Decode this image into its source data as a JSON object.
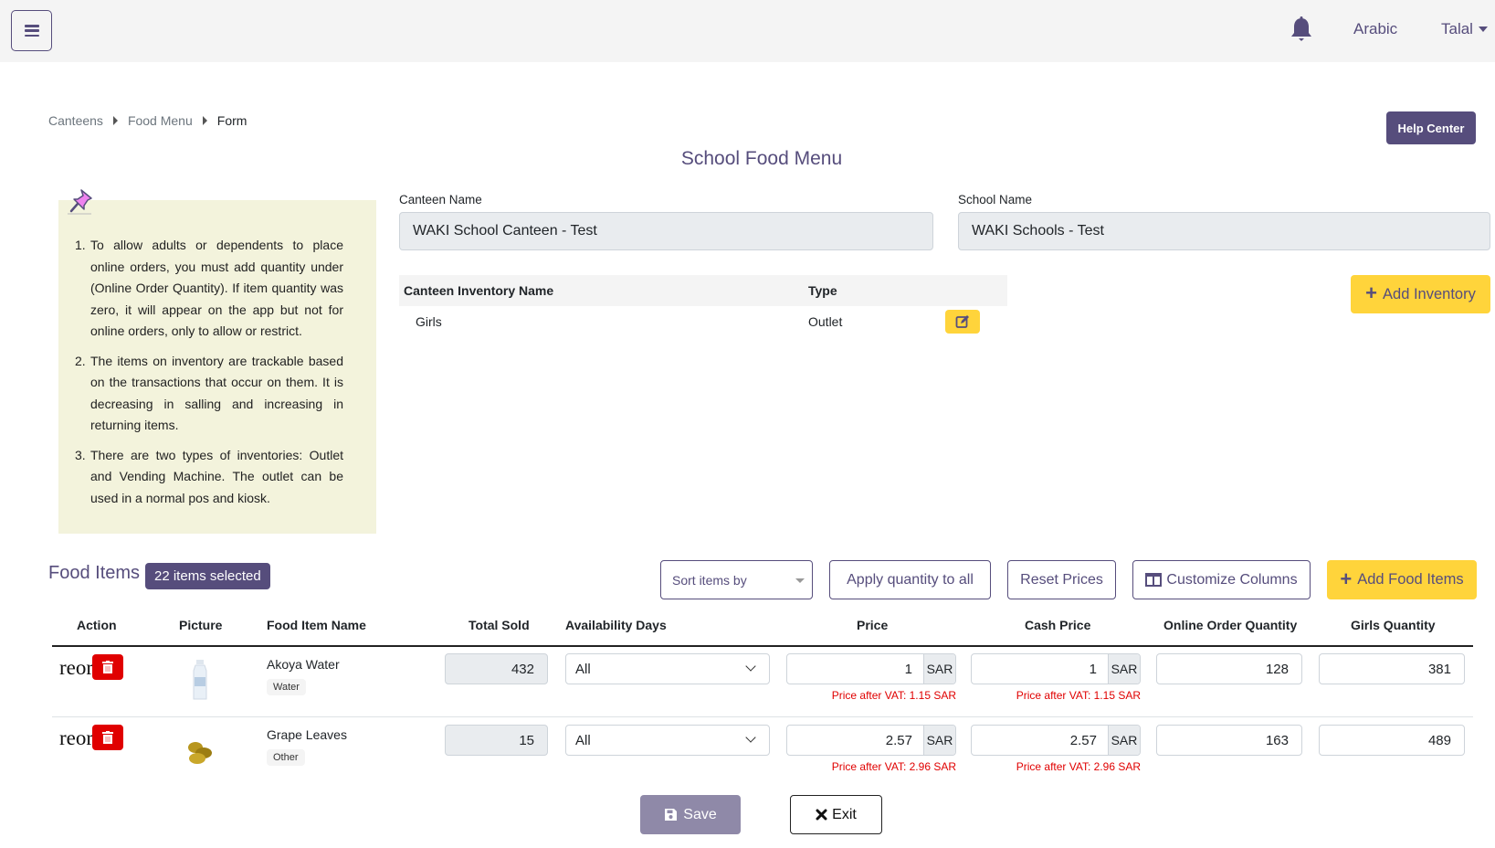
{
  "navbar": {
    "language_label": "Arabic",
    "user_label": "Talal"
  },
  "breadcrumb": [
    {
      "label": "Canteens"
    },
    {
      "label": "Food Menu"
    },
    {
      "label": "Form"
    }
  ],
  "help_center_label": "Help Center",
  "page_title": "School Food Menu",
  "info_notes": [
    {
      "num": "1.",
      "text": "To allow adults or dependents to place online orders, you must add quantity under (Online Order Quantity). If item quantity was zero, it will appear on the app but not for online orders, only to allow or restrict."
    },
    {
      "num": "2.",
      "text": "The items on inventory are trackable based on the transactions that occur on them. It is decreasing in salling and increasing in returning items."
    },
    {
      "num": "3.",
      "text": "There are two types of inventories: Outlet and Vending Machine. The outlet can be used in a normal pos and kiosk."
    }
  ],
  "form": {
    "canteen_name_label": "Canteen Name",
    "canteen_name_value": "WAKI School Canteen - Test",
    "school_name_label": "School Name",
    "school_name_value": "WAKI Schools - Test"
  },
  "inventory_table": {
    "headers": [
      "Canteen Inventory Name",
      "Type"
    ],
    "rows": [
      {
        "name": "Girls",
        "type": "Outlet"
      }
    ]
  },
  "add_inventory_label": "Add Inventory",
  "food_items": {
    "title": "Food Items",
    "selected_badge": "22 items selected",
    "sort_placeholder": "Sort items by",
    "apply_quantity_label": "Apply quantity to all",
    "reset_prices_label": "Reset Prices",
    "customize_columns_label": "Customize Columns",
    "add_food_items_label": "Add Food Items",
    "headers": [
      "Action",
      "Picture",
      "Food Item Name",
      "Total Sold",
      "Availability Days",
      "Price",
      "Cash Price",
      "Online Order Quantity",
      "Girls Quantity"
    ],
    "rows": [
      {
        "reorder_text": "reorder",
        "name": "Akoya Water",
        "category": "Water",
        "total_sold": "432",
        "availability": "All",
        "price": "1",
        "price_currency": "SAR",
        "price_vat": "Price after VAT: 1.15 SAR",
        "cash_price": "1",
        "cash_currency": "SAR",
        "cash_vat": "Price after VAT: 1.15 SAR",
        "online_qty": "128",
        "girls_qty": "381"
      },
      {
        "reorder_text": "reorder",
        "name": "Grape Leaves",
        "category": "Other",
        "total_sold": "15",
        "availability": "All",
        "price": "2.57",
        "price_currency": "SAR",
        "price_vat": "Price after VAT: 2.96 SAR",
        "cash_price": "2.57",
        "cash_currency": "SAR",
        "cash_vat": "Price after VAT: 2.96 SAR",
        "online_qty": "163",
        "girls_qty": "489"
      }
    ]
  },
  "save_label": "Save",
  "exit_label": "Exit",
  "colors": {
    "brand": "#564d7c",
    "accent_yellow": "#ffd43b",
    "danger": "#e00000",
    "info_bg": "#f3f3dc"
  }
}
